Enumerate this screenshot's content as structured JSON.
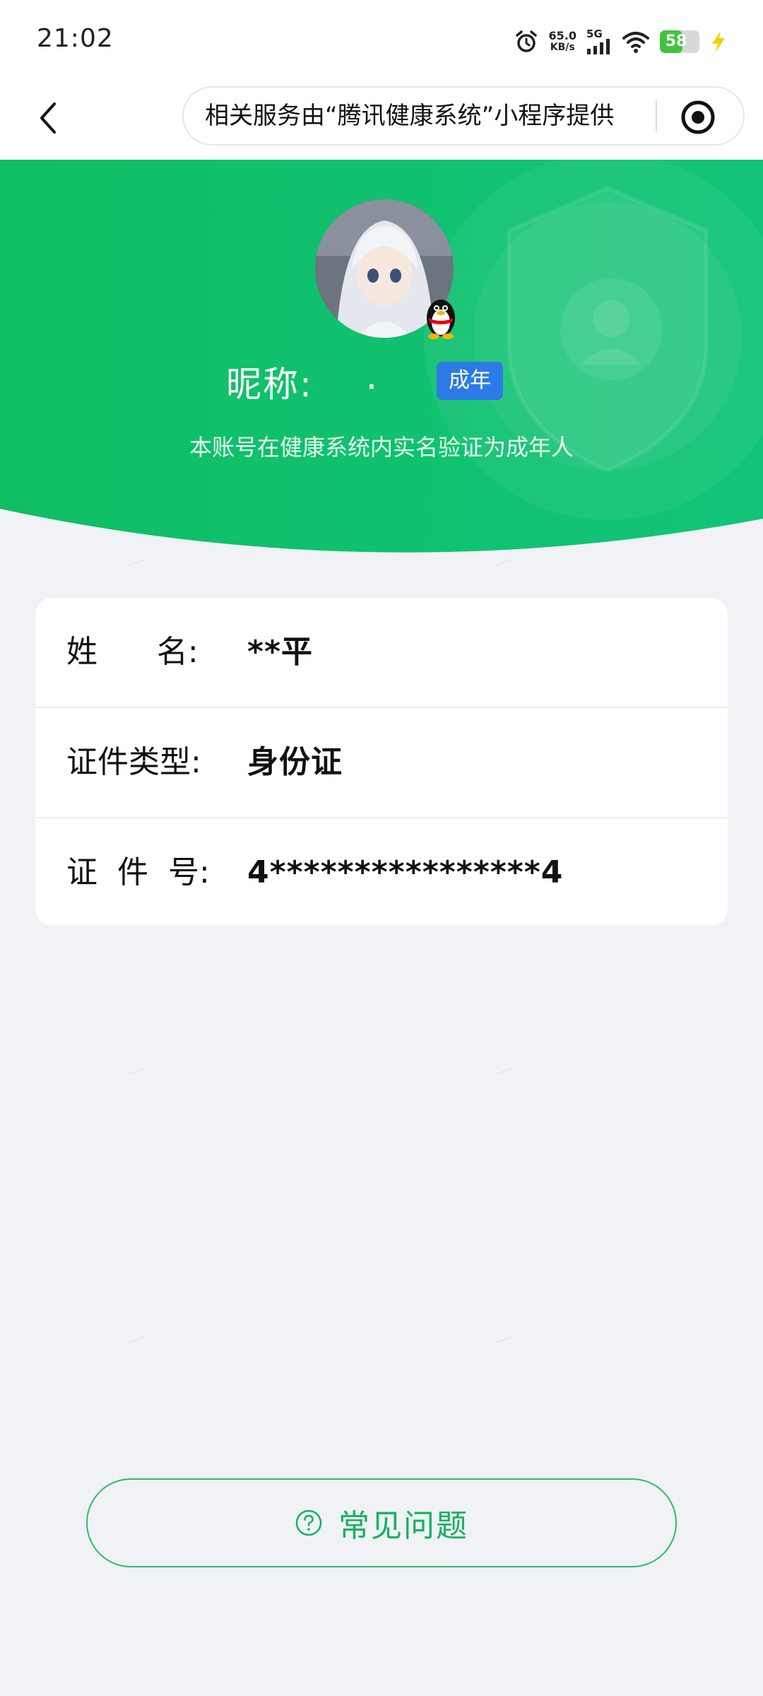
{
  "status_bar": {
    "time": "21:02",
    "net_speed_value": "65.0",
    "net_speed_unit": "KB/s",
    "network": "5G",
    "battery_level": "58"
  },
  "nav": {
    "provider_notice": "相关服务由“腾讯健康系统”小程序提供"
  },
  "profile": {
    "nickname_label": "昵称:",
    "nickname_value": ".",
    "adult_badge": "成年",
    "verification_text": "本账号在健康系统内实名验证为成年人"
  },
  "info": [
    {
      "label": "姓      名:",
      "value": "**平"
    },
    {
      "label": "证件类型:",
      "value": "身份证"
    },
    {
      "label": "证  件  号:",
      "value": "4****************4"
    }
  ],
  "faq": {
    "label": "常见问题"
  },
  "colors": {
    "brand_green": "#07c160",
    "badge_blue": "#2c7be5",
    "faq_green": "#16b15f"
  }
}
